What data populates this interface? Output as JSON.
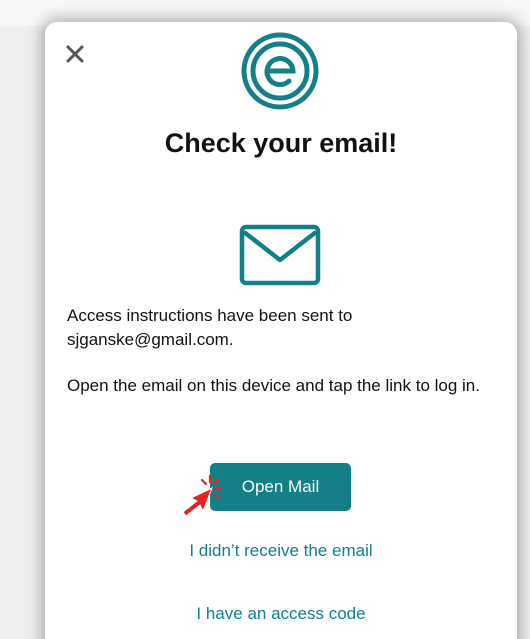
{
  "header": {
    "close_icon": "close-icon",
    "logo_icon": "e-logo-icon",
    "title": "Check your email!"
  },
  "content": {
    "mail_icon": "envelope-icon",
    "message_sent": "Access instructions have been sent to sjganske@gmail.com.",
    "message_instructions": "Open the email on this device and tap the link to log in."
  },
  "actions": {
    "open_mail_label": "Open Mail",
    "not_received_label": "I didn’t receive the email",
    "access_code_label": "I have an access code"
  },
  "overlay": {
    "cursor_icon": "tap-pointer-icon"
  },
  "colors": {
    "brand": "#137f86",
    "background": "#efefef",
    "sheet": "#ffffff",
    "text": "#111111",
    "cursor": "#e8231f"
  }
}
